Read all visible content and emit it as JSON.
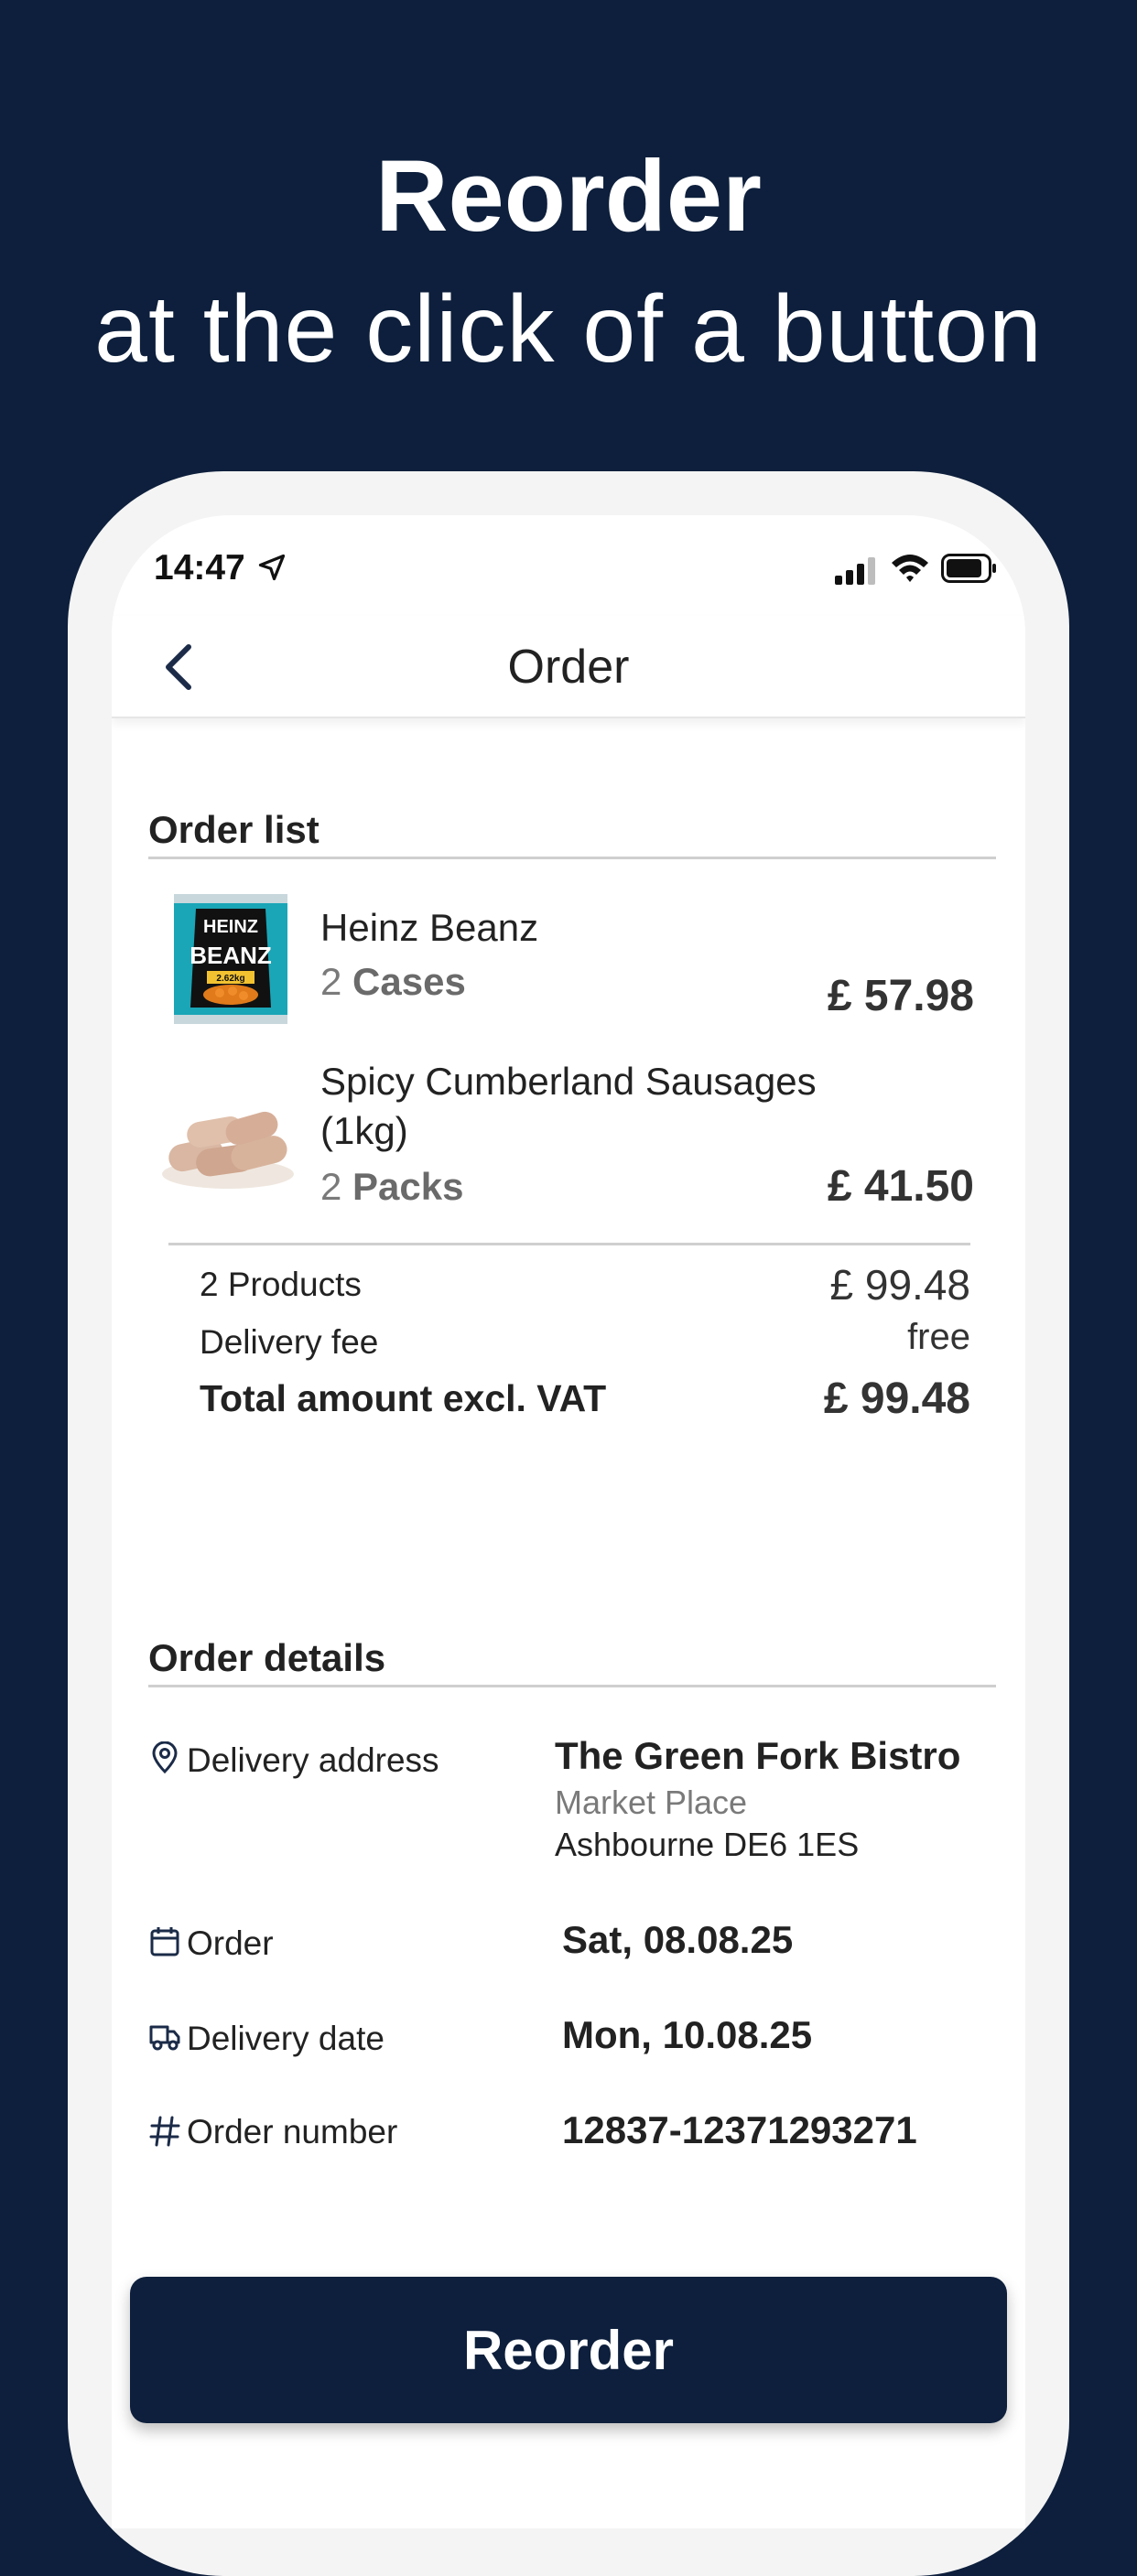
{
  "hero": {
    "title": "Reorder",
    "subtitle": "at the click of a button"
  },
  "status_bar": {
    "time": "14:47"
  },
  "nav": {
    "title": "Order"
  },
  "order_list": {
    "title": "Order list",
    "items": [
      {
        "name": "Heinz Beanz",
        "qty_num": "2",
        "qty_unit": "Cases",
        "price": "£ 57.98"
      },
      {
        "name": "Spicy Cumberland Sausages (1kg)",
        "qty_num": "2",
        "qty_unit": "Packs",
        "price": "£ 41.50"
      }
    ],
    "summary": {
      "products_label": "2 Products",
      "products_value": "£ 99.48",
      "delivery_label": "Delivery fee",
      "delivery_value": "free",
      "total_label": "Total amount excl. VAT",
      "total_value": "£ 99.48"
    }
  },
  "order_details": {
    "title": "Order details",
    "delivery_address_label": "Delivery address",
    "address_name": "The Green Fork Bistro",
    "address_line1": "Market Place",
    "address_line2": "Ashbourne DE6 1ES",
    "order_label": "Order",
    "order_value": "Sat, 08.08.25",
    "delivery_date_label": "Delivery date",
    "delivery_date_value": "Mon, 10.08.25",
    "order_number_label": "Order number",
    "order_number_value": "12837-12371293271"
  },
  "reorder_button": "Reorder",
  "can_label": {
    "brand": "HEINZ",
    "product": "BEANZ",
    "weight": "2.62kg"
  },
  "icons": [
    "location-arrow-icon",
    "signal-icon",
    "wifi-icon",
    "battery-icon",
    "back-chevron-icon",
    "map-pin-icon",
    "calendar-icon",
    "truck-icon",
    "hash-icon"
  ],
  "colors": {
    "brand_navy": "#0d1f3c",
    "background": "#ffffff",
    "muted_text": "#7a7a7a"
  }
}
